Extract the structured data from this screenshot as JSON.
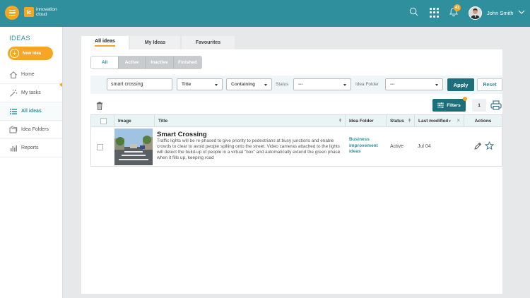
{
  "header": {
    "logo_mark": "ic",
    "logo_line1": "innovation",
    "logo_line2": "cloud",
    "notification_count": "41",
    "user_name": "John Smith"
  },
  "sidebar": {
    "title": "IDEAS",
    "new_idea_label": "New idea",
    "items": [
      {
        "label": "Home",
        "icon": "home-icon"
      },
      {
        "label": "My tasks",
        "icon": "magic-wand-icon"
      },
      {
        "label": "All ideas",
        "icon": "list-icon",
        "active": true
      },
      {
        "label": "Idea Folders",
        "icon": "folders-icon"
      },
      {
        "label": "Reports",
        "icon": "bar-chart-icon"
      }
    ]
  },
  "tabs": [
    {
      "label": "All ideas",
      "active": true
    },
    {
      "label": "My Ideas"
    },
    {
      "label": "Favourites"
    }
  ],
  "status_filter": [
    "All",
    "Active",
    "Inactive",
    "Finished"
  ],
  "filters": {
    "search_value": "smart crossing",
    "field_select": "Title",
    "match_select": "Containing",
    "status_label": "Status",
    "status_value": "---",
    "folder_label": "Idea Folder",
    "folder_value": "---",
    "apply_label": "Apply",
    "reset_label": "Reset"
  },
  "toolbar": {
    "filters_label": "Filters",
    "page_count": "1"
  },
  "table": {
    "columns": [
      "Image",
      "Title",
      "Idea Folder",
      "Status",
      "Last modified",
      "Actions"
    ],
    "rows": [
      {
        "title": "Smart Crossing",
        "description": "Traffic lights will be re-phased to give priority to pedestrians at busy junctions and enable crowds to clear to avoid people spilling onto the street. Video cameras attached to the lights will detect the build-up of people in a virtual \"box\" and automatically extend the green phase when it fills up, keeping road",
        "folder": "Business improvement ideas",
        "status": "Active",
        "last_modified": "Jul 04"
      }
    ]
  },
  "colors": {
    "header_teal": "#2f8f9c",
    "accent_orange": "#f5a623",
    "button_dark_teal": "#1e6f7c"
  }
}
